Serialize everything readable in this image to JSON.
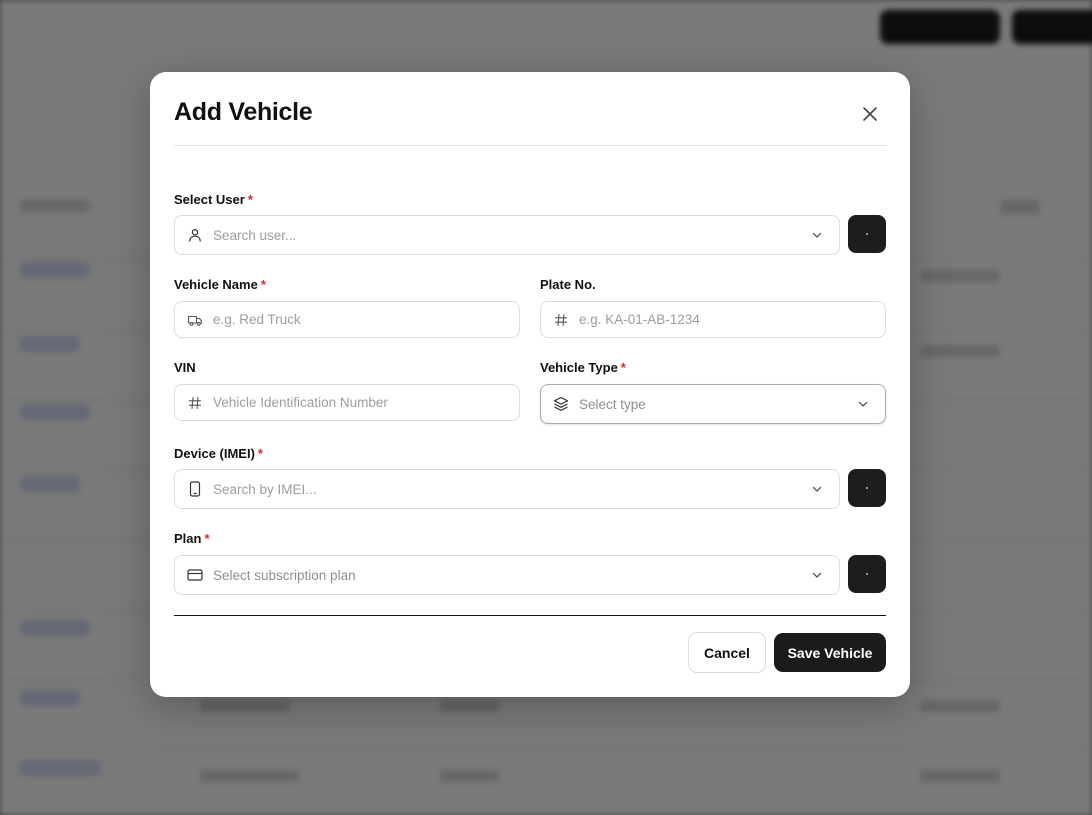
{
  "modal": {
    "title": "Add Vehicle"
  },
  "form": {
    "user": {
      "label": "Select User",
      "required": "*",
      "placeholder": "Search user..."
    },
    "vehicle_name": {
      "label": "Vehicle Name",
      "required": "*",
      "placeholder": "e.g. Red Truck"
    },
    "plate_no": {
      "label": "Plate No.",
      "placeholder": "e.g. KA-01-AB-1234"
    },
    "vin": {
      "label": "VIN",
      "placeholder": "Vehicle Identification Number"
    },
    "vehicle_type": {
      "label": "Vehicle Type",
      "required": "*",
      "placeholder": "Select type"
    },
    "device": {
      "label": "Device (IMEI)",
      "required": "*",
      "placeholder": "Search by IMEI..."
    },
    "plan": {
      "label": "Plan",
      "required": "*",
      "placeholder": "Select subscription plan"
    }
  },
  "footer": {
    "cancel_label": "Cancel",
    "save_label": "Save Vehicle"
  },
  "icons": {
    "close": "close-icon",
    "user": "user-icon",
    "truck": "truck-icon",
    "hash": "hash-icon",
    "layers": "layers-icon",
    "device": "phone-icon",
    "card": "credit-card-icon",
    "chevron": "chevron-down-icon"
  },
  "colors": {
    "accent_dark": "#1b1b1b",
    "required": "#e0242b",
    "overlay": "rgba(0,0,0,0.5)"
  }
}
